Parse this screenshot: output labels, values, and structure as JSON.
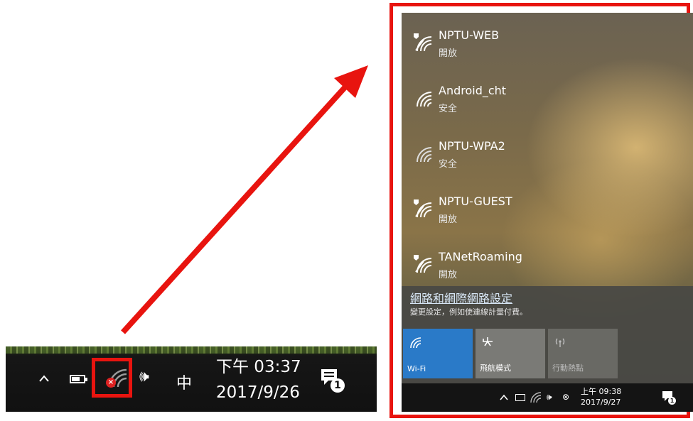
{
  "taskbar": {
    "time": "下午 03:37",
    "date": "2017/9/26",
    "ime_label": "中",
    "notification_count": "1"
  },
  "flyout": {
    "networks": [
      {
        "name": "NPTU-WEB",
        "status": "開放",
        "secured": false
      },
      {
        "name": "Android_cht",
        "status": "安全",
        "secured": true
      },
      {
        "name": "NPTU-WPA2",
        "status": "安全",
        "secured": true
      },
      {
        "name": "NPTU-GUEST",
        "status": "開放",
        "secured": false
      },
      {
        "name": "TANetRoaming",
        "status": "開放",
        "secured": false
      }
    ],
    "settings_link": "網路和網際網路設定",
    "settings_desc": "變更設定，例如使連線計量付費。",
    "tiles": {
      "wifi": "Wi-Fi",
      "airplane": "飛航模式",
      "hotspot": "行動熱點"
    },
    "taskbar": {
      "time": "上午 09:38",
      "date": "2017/9/27",
      "notification_count": "1"
    }
  },
  "colors": {
    "highlight_red": "#e8140f",
    "wifi_tile_blue": "#2a7ac8"
  }
}
